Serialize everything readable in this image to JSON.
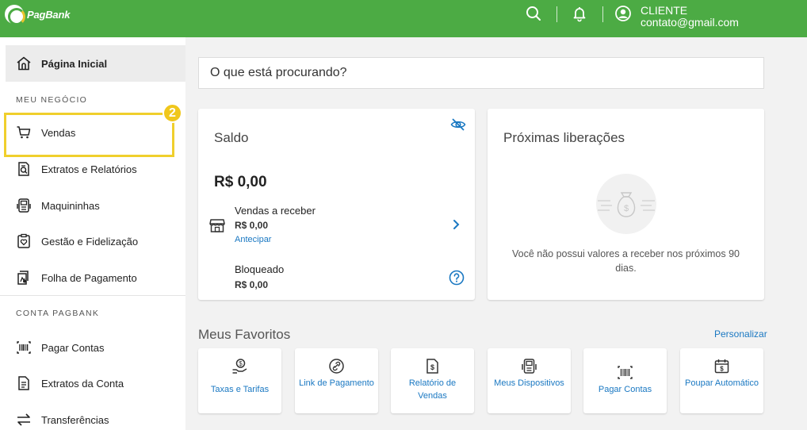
{
  "header": {
    "brand": "PagBank",
    "user_role": "CLIENTE",
    "user_email": "contato@gmail.com"
  },
  "sidebar": {
    "home_label": "Página Inicial",
    "section_business": "MEU NEGÓCIO",
    "business_items": [
      {
        "label": "Vendas",
        "icon": "cart-icon"
      },
      {
        "label": "Extratos e Relatórios",
        "icon": "report-search-icon"
      },
      {
        "label": "Maquininhas",
        "icon": "card-machine-icon"
      },
      {
        "label": "Gestão e Fidelização",
        "icon": "loyalty-icon"
      },
      {
        "label": "Folha de Pagamento",
        "icon": "payroll-icon"
      }
    ],
    "section_account": "CONTA PAGBANK",
    "account_items": [
      {
        "label": "Pagar Contas",
        "icon": "barcode-icon"
      },
      {
        "label": "Extratos da Conta",
        "icon": "statement-icon"
      },
      {
        "label": "Transferências",
        "icon": "transfer-icon"
      }
    ],
    "step_badge": "2"
  },
  "search": {
    "placeholder": "O que está procurando?"
  },
  "saldo": {
    "title": "Saldo",
    "value": "R$ 0,00",
    "receivable_title": "Vendas a receber",
    "receivable_value": "R$ 0,00",
    "anticipate_link": "Antecipar",
    "blocked_title": "Bloqueado",
    "blocked_value": "R$ 0,00"
  },
  "releases": {
    "title": "Próximas liberações",
    "empty_message": "Você não possui valores a receber nos próximos 90 dias."
  },
  "favorites": {
    "title": "Meus Favoritos",
    "customize_link": "Personalizar",
    "items": [
      {
        "label": "Taxas e Tarifas",
        "icon": "fees-icon"
      },
      {
        "label": "Link de Pagamento",
        "icon": "payment-link-icon"
      },
      {
        "label": "Relatório de Vendas",
        "icon": "sales-report-icon"
      },
      {
        "label": "Meus Dispositivos",
        "icon": "devices-icon"
      },
      {
        "label": "Pagar Contas",
        "icon": "barcode-icon"
      },
      {
        "label": "Poupar Automático",
        "icon": "auto-save-icon"
      }
    ]
  },
  "colors": {
    "brand_green": "#4cab44",
    "link_blue": "#1a78c2",
    "highlight_yellow": "#f0cf2c"
  }
}
